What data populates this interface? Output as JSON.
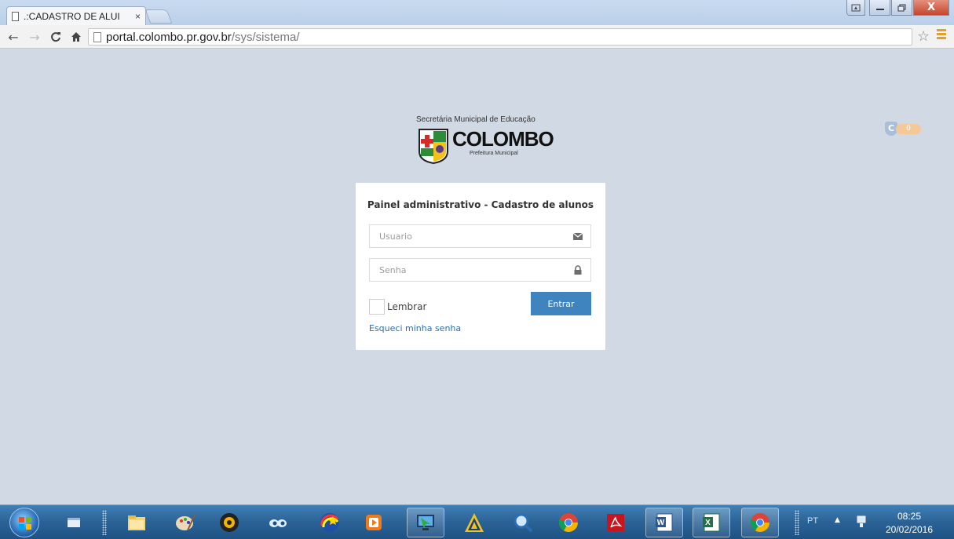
{
  "browser": {
    "tab_title": ".:CADASTRO DE ALUI",
    "tab_close": "×",
    "url_host": "portal.colombo.pr.gov.br",
    "url_path": "/sys/sistema/"
  },
  "window_controls": {
    "close": "X"
  },
  "logo": {
    "subtitle": "Secretária Municipal de Educação",
    "name": "COLOMBO",
    "tagline": "Prefeitura Municipal"
  },
  "badge": {
    "letter": "C",
    "count": "0"
  },
  "login": {
    "title": "Painel administrativo - Cadastro de alunos",
    "username_placeholder": "Usuario",
    "password_placeholder": "Senha",
    "remember_label": "Lembrar",
    "submit_label": "Entrar",
    "forgot_link": "Esqueci minha senha"
  },
  "taskbar": {
    "apps": [
      "windows-explorer",
      "file-manager",
      "paint",
      "media-player",
      "eyes-app",
      "chrome-like",
      "video-player",
      "remote-desktop",
      "archive",
      "search",
      "chrome",
      "acrobat",
      "word",
      "excel",
      "chrome-active"
    ],
    "language": "PT",
    "time": "08:25",
    "date": "20/02/2016"
  }
}
